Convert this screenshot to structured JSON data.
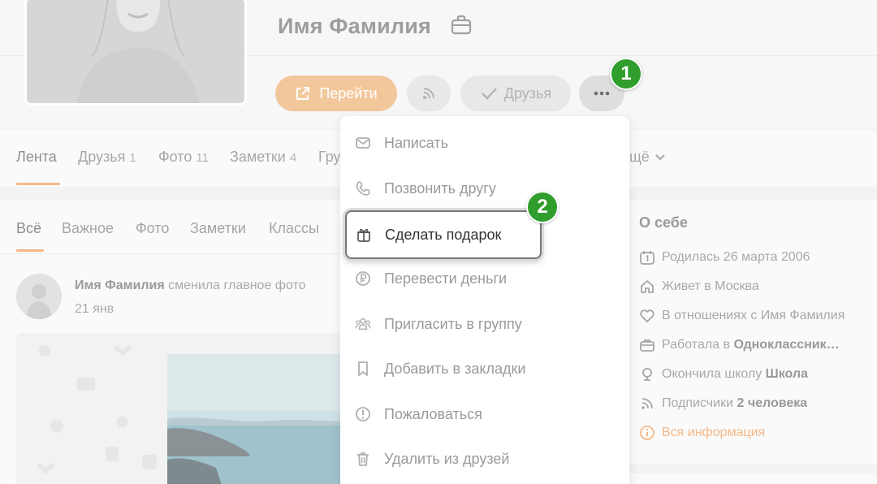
{
  "profile": {
    "name": "Имя Фамилия",
    "buttons": {
      "go": "Перейти",
      "friends": "Друзья"
    }
  },
  "steps": [
    "1",
    "2"
  ],
  "profile_tabs": [
    {
      "label": "Лента",
      "count": ""
    },
    {
      "label": "Друзья",
      "count": "1"
    },
    {
      "label": "Фото",
      "count": "11"
    },
    {
      "label": "Заметки",
      "count": "4"
    },
    {
      "label": "Гру",
      "count": ""
    },
    {
      "label": "щё",
      "count": ""
    }
  ],
  "feed_tabs": [
    "Всё",
    "Важное",
    "Фото",
    "Заметки",
    "Классы"
  ],
  "post": {
    "author": "Имя Фамилия",
    "action": "сменила главное фото",
    "date": "21 янв"
  },
  "about": {
    "title": "О себе",
    "born": "Родилась 26 марта 2006",
    "lives": "Живет в Москва",
    "relationship": "В отношениях с Имя Фамилия",
    "work_prefix": "Работала в",
    "work_place": "Одноклассник…",
    "school_prefix": "Окончила школу",
    "school": "Школа",
    "subscribers_prefix": "Подписчики",
    "subscribers": "2 человека",
    "all_info": "Вся информация"
  },
  "menu": {
    "items": [
      {
        "label": "Написать",
        "icon": "envelope-icon"
      },
      {
        "label": "Позвонить другу",
        "icon": "phone-icon"
      },
      {
        "label": "Сделать подарок",
        "icon": "gift-icon"
      },
      {
        "label": "Перевести деньги",
        "icon": "ruble-icon"
      },
      {
        "label": "Пригласить в группу",
        "icon": "group-icon"
      },
      {
        "label": "Добавить в закладки",
        "icon": "bookmark-icon"
      },
      {
        "label": "Пожаловаться",
        "icon": "warning-icon"
      },
      {
        "label": "Удалить из друзей",
        "icon": "trash-icon"
      }
    ]
  },
  "colors": {
    "accent": "#f2c79c",
    "step_badge": "#2f9e2c",
    "link": "#f4b888"
  }
}
